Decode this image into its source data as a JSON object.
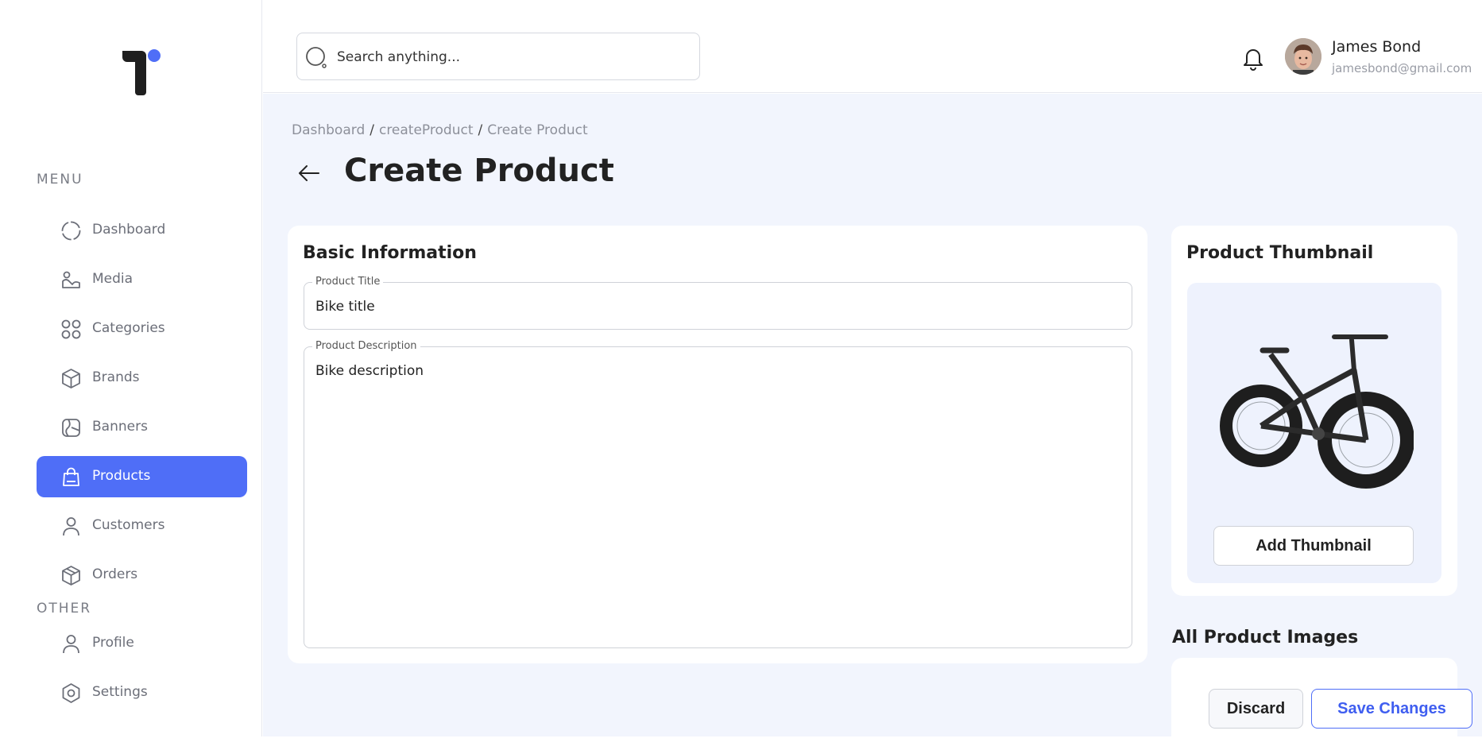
{
  "sidebar": {
    "menu_heading": "MENU",
    "other_heading": "OTHER",
    "menu_items": [
      {
        "label": "Dashboard",
        "icon": "dashboard-icon"
      },
      {
        "label": "Media",
        "icon": "media-icon"
      },
      {
        "label": "Categories",
        "icon": "categories-icon"
      },
      {
        "label": "Brands",
        "icon": "brands-icon"
      },
      {
        "label": "Banners",
        "icon": "banners-icon"
      },
      {
        "label": "Products",
        "icon": "products-icon",
        "active": true
      },
      {
        "label": "Customers",
        "icon": "customers-icon"
      },
      {
        "label": "Orders",
        "icon": "orders-icon"
      }
    ],
    "other_items": [
      {
        "label": "Profile",
        "icon": "profile-icon"
      },
      {
        "label": "Settings",
        "icon": "settings-icon"
      }
    ]
  },
  "header": {
    "search_placeholder": "Search anything...",
    "user_name": "James Bond",
    "user_email": "jamesbond@gmail.com"
  },
  "breadcrumb": [
    "Dashboard",
    "createProduct",
    "Create Product"
  ],
  "page_title": "Create Product",
  "basic_info": {
    "title": "Basic Information",
    "product_title_label": "Product Title",
    "product_title_value": "Bike title",
    "product_description_label": "Product Description",
    "product_description_value": "Bike description"
  },
  "thumbnail": {
    "title": "Product Thumbnail",
    "add_button": "Add Thumbnail"
  },
  "all_images": {
    "title": "All Product Images"
  },
  "actions": {
    "discard": "Discard",
    "save": "Save Changes"
  },
  "colors": {
    "accent": "#4f6ef7",
    "main_bg": "#f2f5fd",
    "logo_dot": "#4f6ef7"
  }
}
